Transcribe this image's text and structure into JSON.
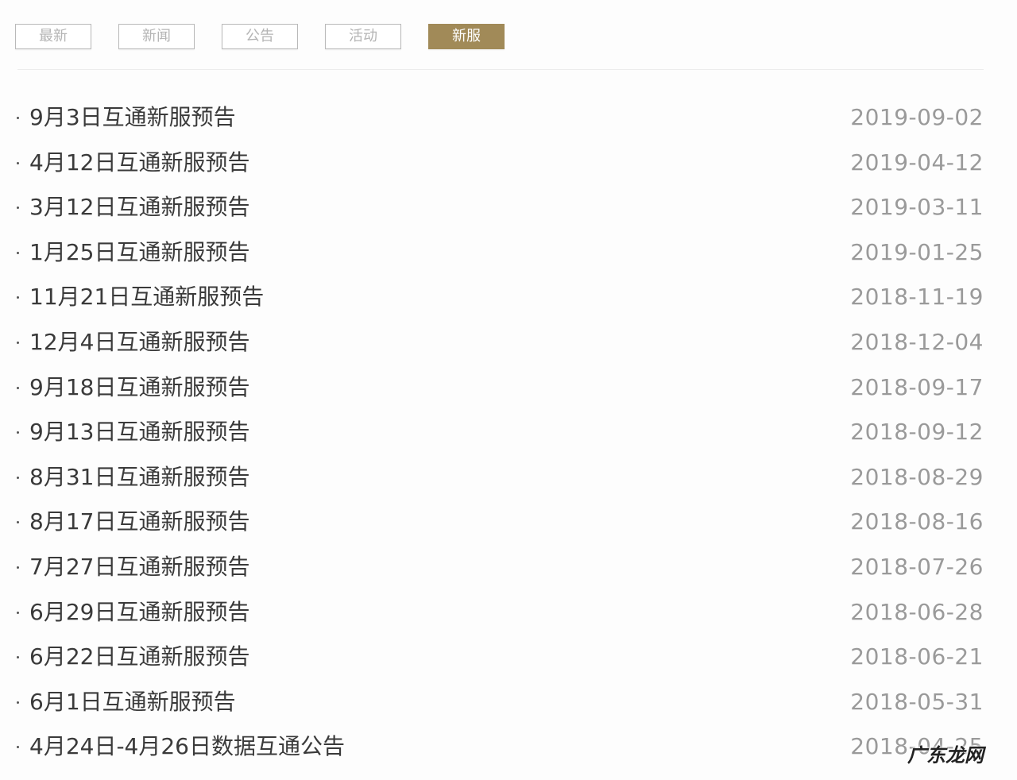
{
  "tabs": [
    {
      "label": "最新",
      "active": false
    },
    {
      "label": "新闻",
      "active": false
    },
    {
      "label": "公告",
      "active": false
    },
    {
      "label": "活动",
      "active": false
    },
    {
      "label": "新服",
      "active": true
    }
  ],
  "articles": [
    {
      "title": "9月3日互通新服预告",
      "date": "2019-09-02"
    },
    {
      "title": "4月12日互通新服预告",
      "date": "2019-04-12"
    },
    {
      "title": "3月12日互通新服预告",
      "date": "2019-03-11"
    },
    {
      "title": "1月25日互通新服预告",
      "date": "2019-01-25"
    },
    {
      "title": "11月21日互通新服预告",
      "date": "2018-11-19"
    },
    {
      "title": "12月4日互通新服预告",
      "date": "2018-12-04"
    },
    {
      "title": "9月18日互通新服预告",
      "date": "2018-09-17"
    },
    {
      "title": "9月13日互通新服预告",
      "date": "2018-09-12"
    },
    {
      "title": "8月31日互通新服预告",
      "date": "2018-08-29"
    },
    {
      "title": "8月17日互通新服预告",
      "date": "2018-08-16"
    },
    {
      "title": "7月27日互通新服预告",
      "date": "2018-07-26"
    },
    {
      "title": "6月29日互通新服预告",
      "date": "2018-06-28"
    },
    {
      "title": "6月22日互通新服预告",
      "date": "2018-06-21"
    },
    {
      "title": "6月1日互通新服预告",
      "date": "2018-05-31"
    },
    {
      "title": "4月24日-4月26日数据互通公告",
      "date": "2018-04-25"
    }
  ],
  "watermark": "广东龙网",
  "colors": {
    "accent": "#a18a58",
    "title_text": "#3a3a3a",
    "date_text": "#9a9a9a"
  }
}
